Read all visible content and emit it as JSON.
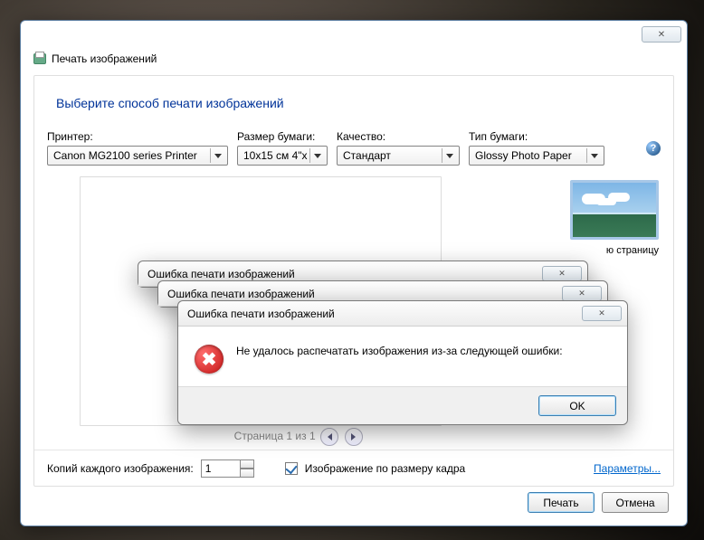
{
  "window": {
    "title": "Печать изображений"
  },
  "heading": "Выберите способ печати изображений",
  "options": {
    "printer_label": "Принтер:",
    "printer_value": "Canon MG2100 series Printer",
    "paper_size_label": "Размер бумаги:",
    "paper_size_value": "10x15 см 4\"x",
    "quality_label": "Качество:",
    "quality_value": "Стандарт",
    "paper_type_label": "Тип бумаги:",
    "paper_type_value": "Glossy Photo Paper"
  },
  "thumb": {
    "option_label": "ю страницу"
  },
  "pager": {
    "text": "Страница 1 из 1"
  },
  "bottom": {
    "copies_label": "Копий каждого изображения:",
    "copies_value": "1",
    "fit_label": "Изображение по размеру кадра",
    "params_link": "Параметры..."
  },
  "footer": {
    "print": "Печать",
    "cancel": "Отмена"
  },
  "dialog": {
    "title": "Ошибка печати изображений",
    "message": "Не удалось распечатать изображения из-за следующей ошибки:",
    "ok": "OK"
  }
}
